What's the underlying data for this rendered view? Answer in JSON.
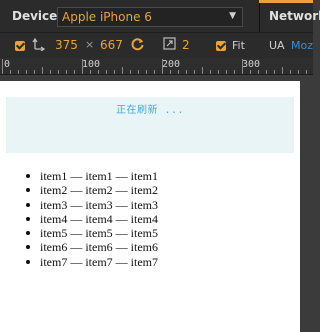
{
  "toolbar": {
    "device_label": "Device",
    "device_value": "Apple iPhone 6",
    "network_label": "Network",
    "width": "375",
    "times": "×",
    "height": "667",
    "zoom": "2",
    "fit_label": "Fit",
    "ua_label": "UA",
    "ua_value": "Moz"
  },
  "ruler": {
    "labels": [
      "0",
      "100",
      "200",
      "300"
    ]
  },
  "viewport": {
    "refresh_text": "正在刷新 ...",
    "items": [
      "item1 — item1 — item1",
      "item2 — item2 — item2",
      "item3 — item3 — item3",
      "item4 — item4 — item4",
      "item5 — item5 — item5",
      "item6 — item6 — item6",
      "item7 — item7 — item7"
    ]
  },
  "colors": {
    "accent": "#e8a33d",
    "link": "#3a8ed6",
    "refresh_text": "#49a9d6",
    "refresh_bg": "#e8f4f6"
  }
}
